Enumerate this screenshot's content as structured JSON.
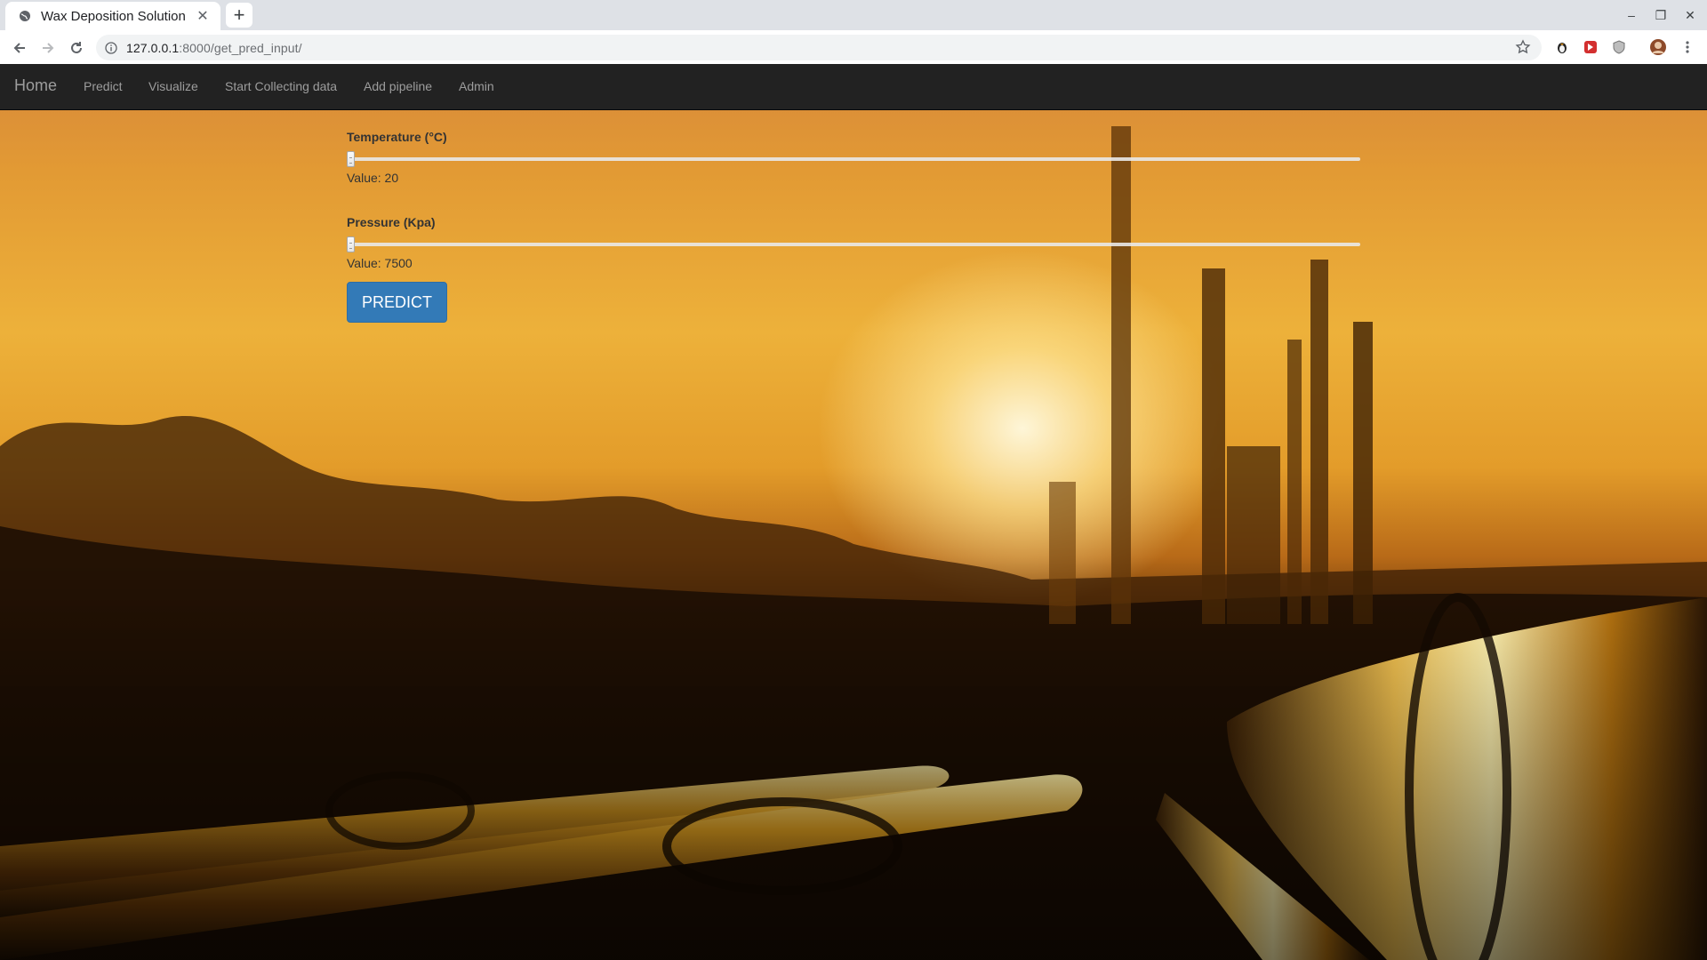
{
  "browser": {
    "tab_title": "Wax Deposition Solution",
    "url_host": "127.0.0.1",
    "url_rest": ":8000/get_pred_input/"
  },
  "navbar": {
    "brand": "Home",
    "links": [
      "Predict",
      "Visualize",
      "Start Collecting data",
      "Add pipeline",
      "Admin"
    ]
  },
  "form": {
    "temperature": {
      "label": "Temperature (°C)",
      "value_text": "Value: 20",
      "value": 20
    },
    "pressure": {
      "label": "Pressure (Kpa)",
      "value_text": "Value: 7500",
      "value": 7500
    },
    "submit_label": "PREDICT"
  },
  "colors": {
    "navbar_bg": "#222222",
    "button_bg": "#337ab7",
    "button_text": "#ffffff"
  }
}
